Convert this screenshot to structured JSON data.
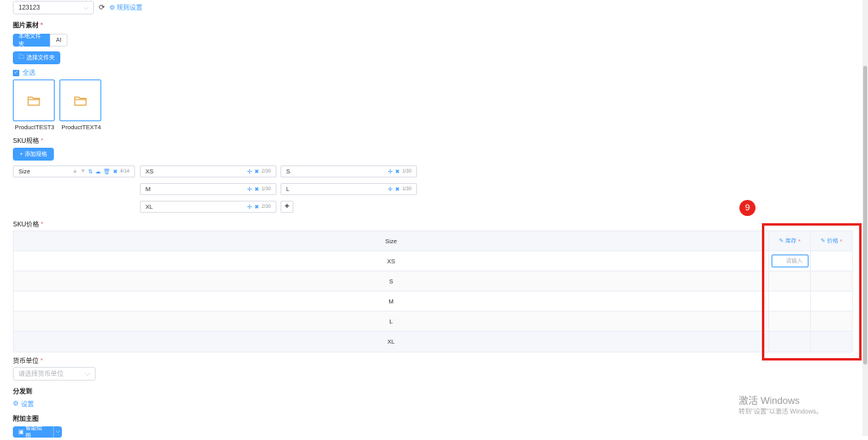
{
  "rule_select": {
    "value": "123123",
    "settings_link": "规则设置"
  },
  "image_material": {
    "title": "图片素材",
    "required_mark": "*",
    "tabs": [
      "本地文件夹",
      "AI"
    ],
    "select_folder_button": "选择文件夹",
    "select_all_label": "全选",
    "folders": [
      "ProductTEST3",
      "ProductTEXT4"
    ]
  },
  "sku_spec": {
    "title": "SKU规格",
    "required_mark": "*",
    "add_button": "添加规格",
    "spec_name": "Size",
    "spec_count": "4/14",
    "values": [
      {
        "label": "XS",
        "count": "2/30"
      },
      {
        "label": "S",
        "count": "1/30"
      },
      {
        "label": "M",
        "count": "1/30"
      },
      {
        "label": "L",
        "count": "1/30"
      },
      {
        "label": "XL",
        "count": "2/30"
      }
    ]
  },
  "sku_price": {
    "title": "SKU价格",
    "required_mark": "*",
    "headers": {
      "size": "Size",
      "stock": "库存",
      "price": "价格"
    },
    "rows": [
      "XS",
      "S",
      "M",
      "L",
      "XL"
    ],
    "stock_placeholder": "请输入"
  },
  "currency": {
    "title": "货币单位",
    "required_mark": "*",
    "placeholder": "请选择货币单位"
  },
  "distribute": {
    "title": "分发到",
    "settings_link": "设置"
  },
  "extra_image": {
    "title": "附加主图",
    "button": "智能绘图"
  },
  "annotation": {
    "marker": "9"
  },
  "watermark": {
    "line1": "激活 Windows",
    "line2": "转到\"设置\"以激活 Windows。"
  },
  "colors": {
    "accent": "#409eff",
    "danger": "#e8231d",
    "required": "#f56c6c"
  }
}
